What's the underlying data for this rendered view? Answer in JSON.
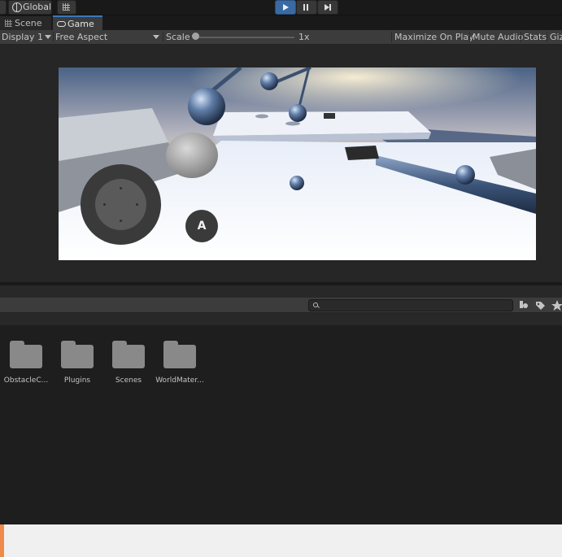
{
  "toolbar": {
    "global_label": "Global",
    "play_icon": "play-icon",
    "pause_icon": "pause-icon",
    "step_icon": "step-icon",
    "accent": "#3a6aa3"
  },
  "tabs": [
    {
      "label": "Scene",
      "icon": "scene-grid-icon"
    },
    {
      "label": "Game",
      "icon": "game-controller-icon",
      "active": true
    }
  ],
  "game_bar": {
    "display": "Display 1",
    "aspect": "Free Aspect",
    "scale_label": "Scale",
    "scale_value": "1x",
    "maximize": "Maximize On Play",
    "mute": "Mute Audio",
    "stats": "Stats",
    "gizmos": "Gizmos"
  },
  "game_view": {
    "action_button": "A"
  },
  "project": {
    "search_placeholder": "",
    "folders": [
      {
        "name": "ObstacleC..."
      },
      {
        "name": "Plugins"
      },
      {
        "name": "Scenes"
      },
      {
        "name": "WorldMater..."
      }
    ]
  }
}
